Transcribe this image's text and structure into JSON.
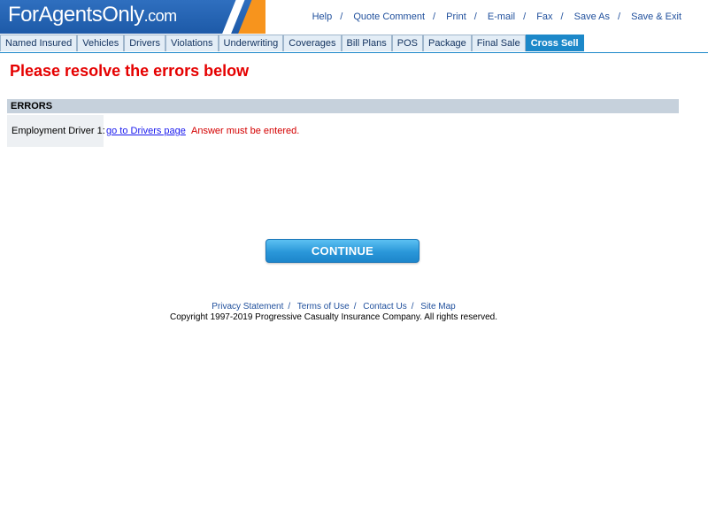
{
  "header": {
    "logo_main": "ForAgentsOnly",
    "logo_suffix": ".com",
    "top_links": [
      "Help",
      "Quote Comment",
      "Print",
      "E-mail",
      "Fax",
      "Save As",
      "Save & Exit"
    ],
    "separator": "/"
  },
  "tabs": [
    {
      "label": "Named Insured",
      "active": false
    },
    {
      "label": "Vehicles",
      "active": false
    },
    {
      "label": "Drivers",
      "active": false
    },
    {
      "label": "Violations",
      "active": false
    },
    {
      "label": "Underwriting",
      "active": false
    },
    {
      "label": "Coverages",
      "active": false
    },
    {
      "label": "Bill Plans",
      "active": false
    },
    {
      "label": "POS",
      "active": false
    },
    {
      "label": "Package",
      "active": false
    },
    {
      "label": "Final Sale",
      "active": false
    },
    {
      "label": "Cross Sell",
      "active": true
    }
  ],
  "main": {
    "title": "Please resolve the errors below",
    "errors_header": "ERRORS",
    "errors": [
      {
        "field": "Employment Driver 1:",
        "link": "go to Drivers page",
        "message": "Answer must be entered."
      }
    ],
    "continue_label": "CONTINUE"
  },
  "footer": {
    "links": [
      "Privacy Statement",
      "Terms of Use",
      "Contact Us",
      "Site Map"
    ],
    "separator": "/",
    "copyright": "Copyright 1997-2019 Progressive Casualty Insurance Company. All rights reserved."
  },
  "colors": {
    "brand_blue": "#1d5aa8",
    "brand_orange": "#f7941d",
    "active_tab": "#1c88c9",
    "error_red": "#e50000"
  }
}
